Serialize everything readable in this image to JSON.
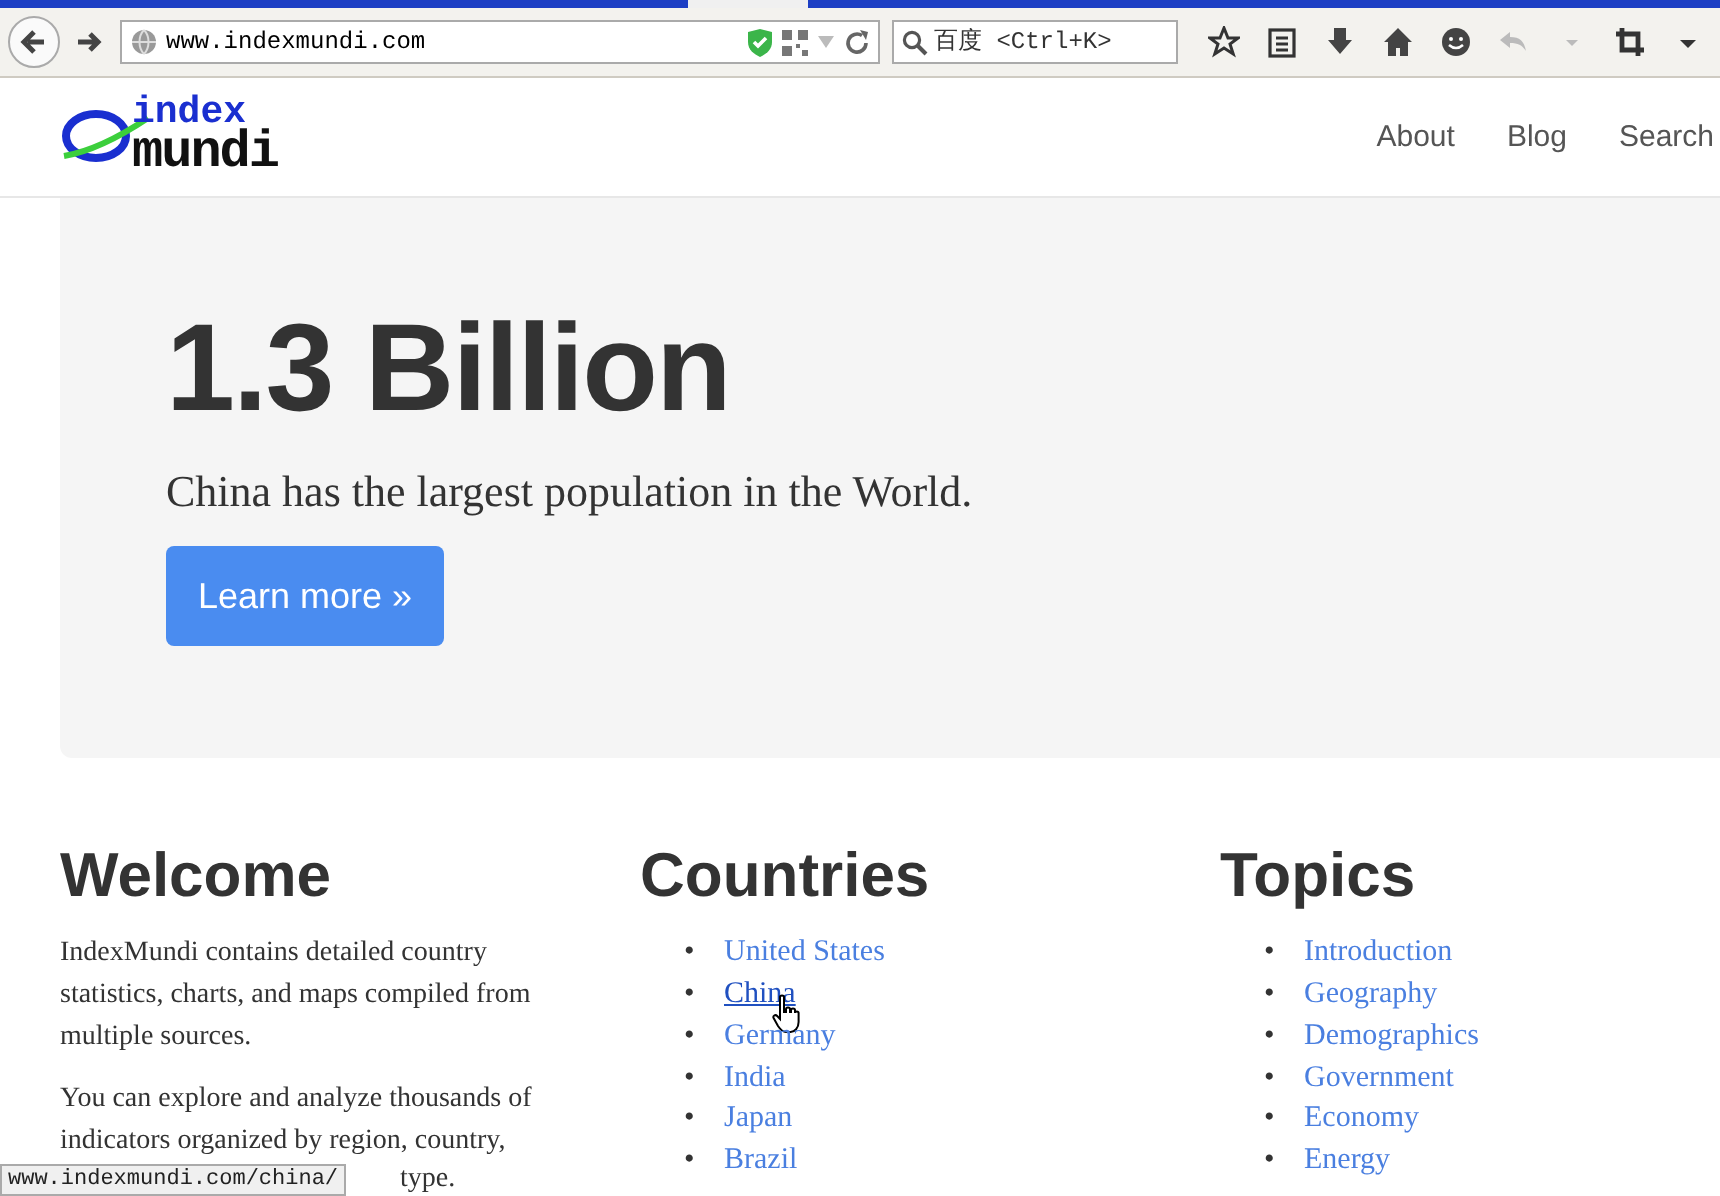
{
  "browser": {
    "address": "www.indexmundi.com",
    "search_placeholder": "百度 <Ctrl+K>",
    "status_url": "www.indexmundi.com/china/"
  },
  "site": {
    "logo_top": "index",
    "logo_bottom": "mundi",
    "nav": [
      "About",
      "Blog",
      "Search"
    ]
  },
  "hero": {
    "headline": "1.3 Billion",
    "subtitle": "China has the largest population in the World.",
    "button": "Learn more »"
  },
  "welcome": {
    "title": "Welcome",
    "paragraphs": [
      "IndexMundi contains detailed country statistics, charts, and maps compiled from multiple sources.",
      "You can explore and analyze thousands of indicators organized by region, country,"
    ],
    "cut_line": "type."
  },
  "bullet": "•",
  "countries": {
    "title": "Countries",
    "items": [
      {
        "label": "United States",
        "hovered": false
      },
      {
        "label": "China",
        "hovered": true
      },
      {
        "label": "Germany",
        "hovered": false
      },
      {
        "label": "India",
        "hovered": false
      },
      {
        "label": "Japan",
        "hovered": false
      },
      {
        "label": "Brazil",
        "hovered": false
      }
    ]
  },
  "topics": {
    "title": "Topics",
    "items": [
      {
        "label": "Introduction",
        "hovered": false
      },
      {
        "label": "Geography",
        "hovered": false
      },
      {
        "label": "Demographics",
        "hovered": false
      },
      {
        "label": "Government",
        "hovered": false
      },
      {
        "label": "Economy",
        "hovered": false
      },
      {
        "label": "Energy",
        "hovered": false
      }
    ]
  }
}
